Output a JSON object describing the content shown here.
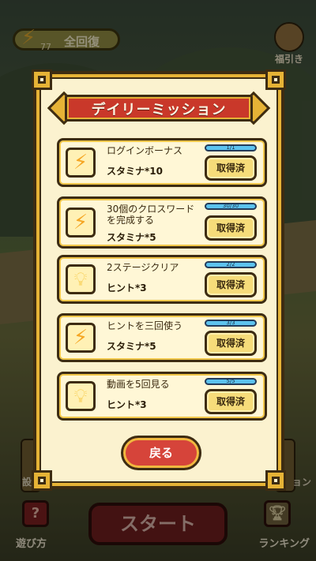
{
  "top_bar": {
    "stamina_count": "77",
    "recover_label": "全回復",
    "fortune_label": "福引き"
  },
  "bottom_bar": {
    "start_label": "スタート",
    "howto_label": "遊び方",
    "ranking_label": "ランキング",
    "left_partial_label": "設",
    "right_partial_label": "ョン"
  },
  "modal": {
    "title": "デイリーミッション",
    "back_label": "戻る",
    "missions": [
      {
        "icon": "lightning-icon",
        "desc": "ログインボーナス",
        "reward": "スタミナ*10",
        "progress": "1/1",
        "progress_fraction": 1.0,
        "button": "取得済"
      },
      {
        "icon": "lightning-icon",
        "desc": "30個のクロスワードを完成する",
        "reward": "スタミナ*5",
        "progress": "30/30",
        "progress_fraction": 1.0,
        "button": "取得済"
      },
      {
        "icon": "lightbulb-icon",
        "desc": "2ステージクリア",
        "reward": "ヒント*3",
        "progress": "2/2",
        "progress_fraction": 1.0,
        "button": "取得済"
      },
      {
        "icon": "lightning-icon",
        "desc": "ヒントを三回使う",
        "reward": "スタミナ*5",
        "progress": "3/3",
        "progress_fraction": 1.0,
        "button": "取得済"
      },
      {
        "icon": "lightbulb-icon",
        "desc": "動画を5回見る",
        "reward": "ヒント*3",
        "progress": "5/5",
        "progress_fraction": 1.0,
        "button": "取得済"
      }
    ]
  },
  "colors": {
    "panel_bg": "#fbf2cf",
    "frame_gold": "#e6b336",
    "outline": "#3d2c12",
    "ribbon_red": "#c9382a",
    "progress_blue": "#5cc3ee"
  }
}
